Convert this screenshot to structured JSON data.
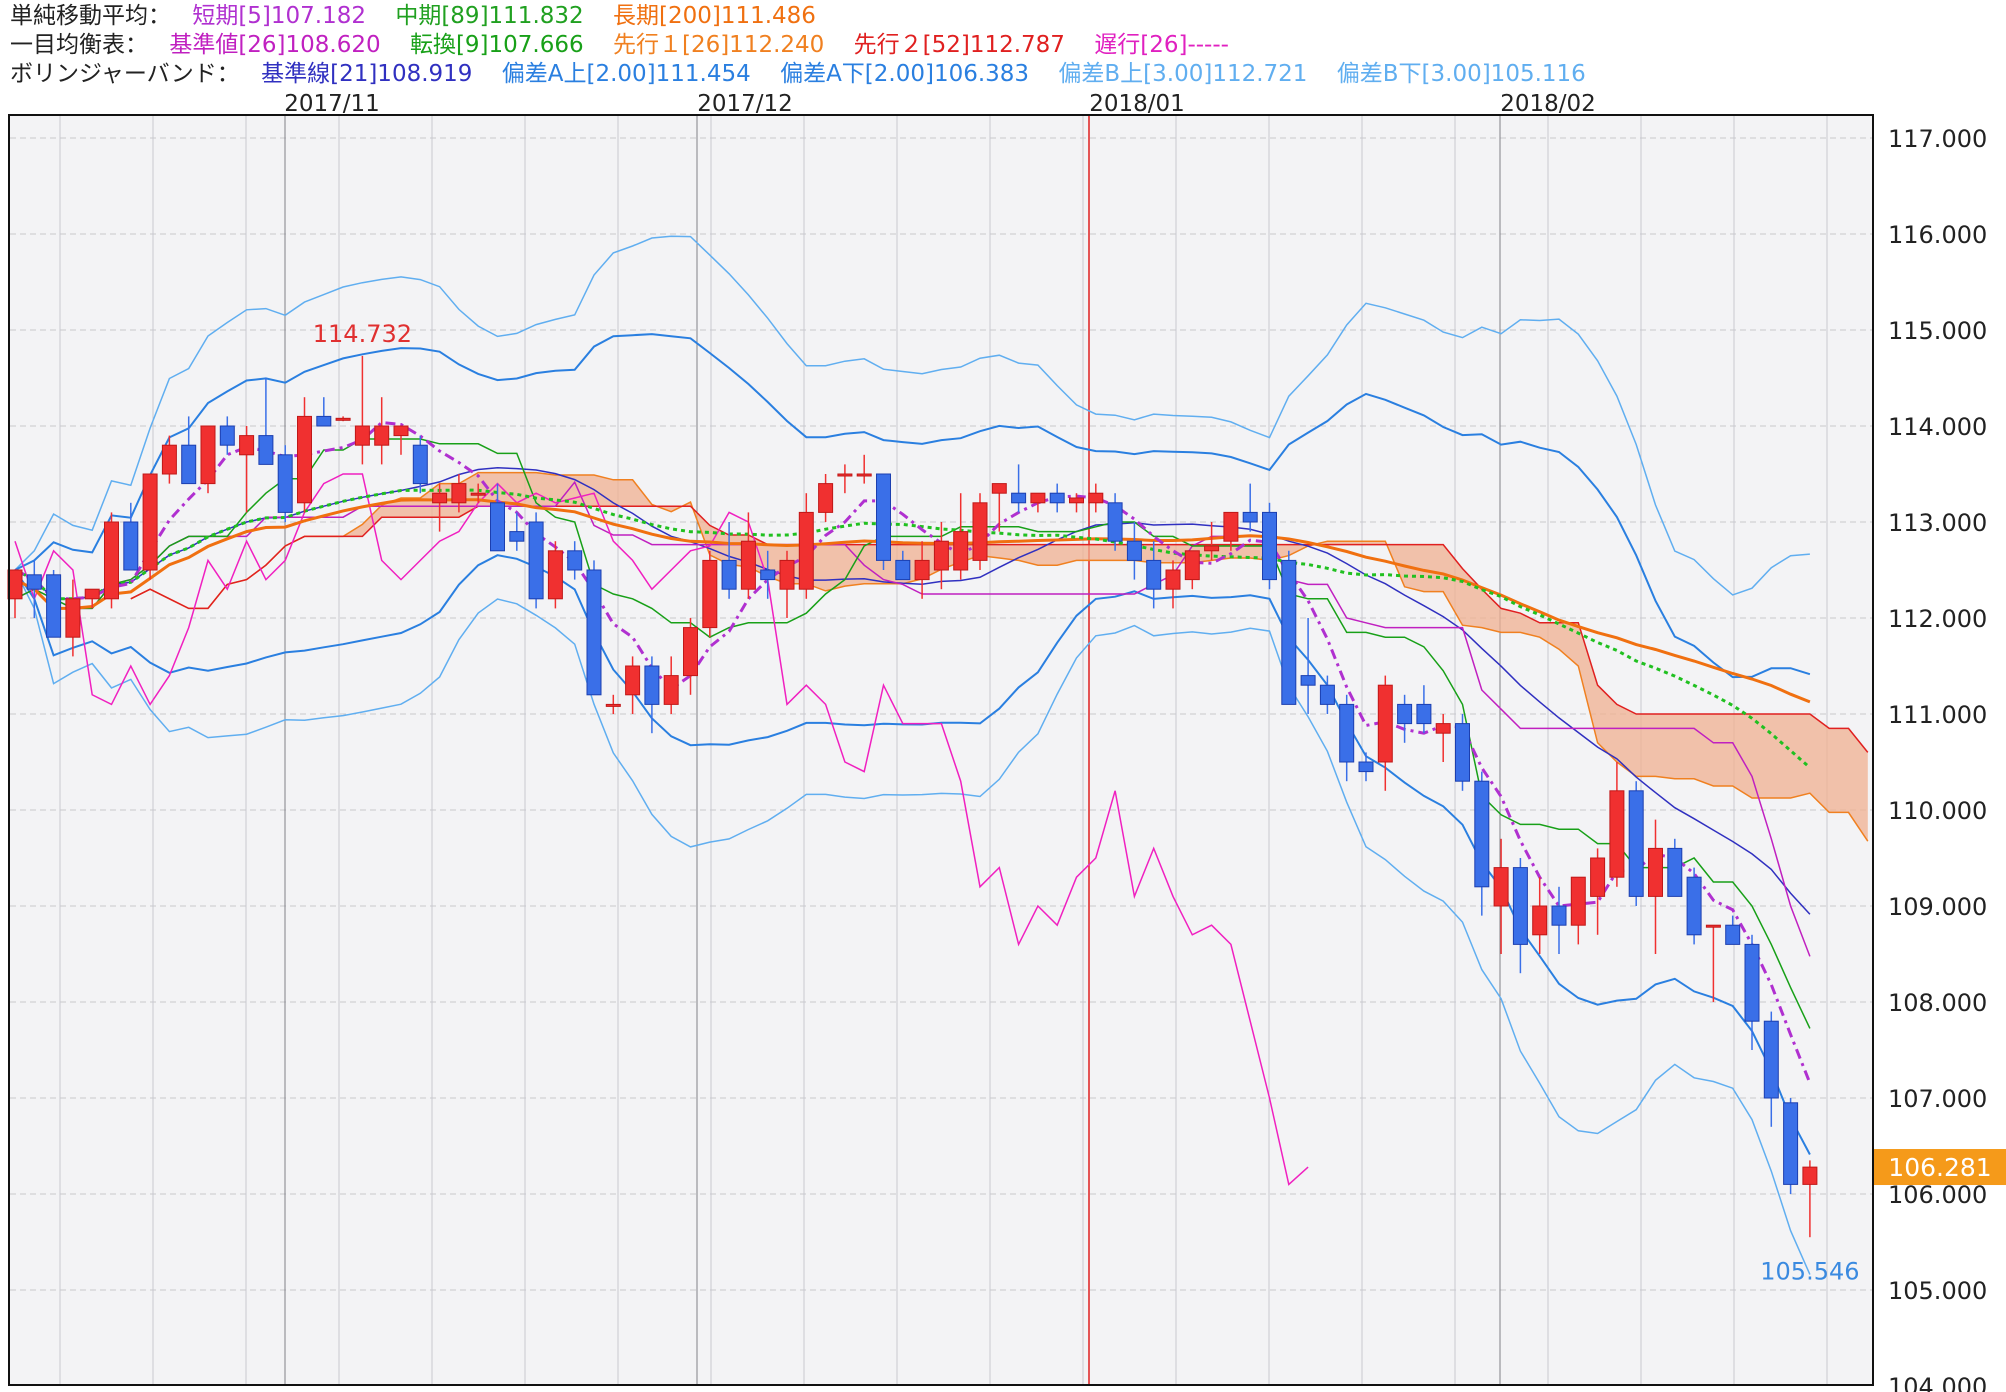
{
  "legend": {
    "sma": {
      "title": "単純移動平均：",
      "items": [
        {
          "label": "短期[5]107.182",
          "color": "#b030d0"
        },
        {
          "label": "中期[89]111.832",
          "color": "#20a020"
        },
        {
          "label": "長期[200]111.486",
          "color": "#f07010"
        }
      ]
    },
    "ichimoku": {
      "title": "一目均衡表：",
      "items": [
        {
          "label": "基準値[26]108.620",
          "color": "#c020c0"
        },
        {
          "label": "転換[9]107.666",
          "color": "#18a018"
        },
        {
          "label": "先行１[26]112.240",
          "color": "#f08020"
        },
        {
          "label": "先行２[52]112.787",
          "color": "#e02020"
        },
        {
          "label": "遅行[26]-----",
          "color": "#e020c0"
        }
      ]
    },
    "bollinger": {
      "title": "ボリンジャーバンド：",
      "items": [
        {
          "label": "基準線[21]108.919",
          "color": "#3030c0"
        },
        {
          "label": "偏差A上[2.00]111.454",
          "color": "#2a7fe0"
        },
        {
          "label": "偏差A下[2.00]106.383",
          "color": "#2a7fe0"
        },
        {
          "label": "偏差B上[3.00]112.721",
          "color": "#60aef0"
        },
        {
          "label": "偏差B下[3.00]105.116",
          "color": "#60aef0"
        }
      ]
    }
  },
  "chart_data": {
    "type": "candlestick",
    "x_labels": [
      "2017/11",
      "2017/12",
      "2018/01",
      "2018/02"
    ],
    "y_ticks": [
      "117.000",
      "116.000",
      "115.000",
      "114.000",
      "113.000",
      "112.000",
      "111.000",
      "110.000",
      "109.000",
      "108.000",
      "107.000",
      "106.000",
      "105.000",
      "104.000"
    ],
    "ylim": [
      104,
      117.3
    ],
    "current_price": "106.281",
    "high_label": "114.732",
    "low_label": "105.546",
    "colors": {
      "up": "#f03030",
      "down": "#3a6fe8",
      "cloud_up": "#f0b090",
      "cloud_down": "#e6e6e8",
      "current_bg": "#f59a1a"
    },
    "candles": [
      {
        "o": 112.2,
        "h": 112.4,
        "l": 112.0,
        "c": 112.5
      },
      {
        "o": 112.45,
        "h": 112.6,
        "l": 112.0,
        "c": 112.3
      },
      {
        "o": 112.45,
        "h": 112.5,
        "l": 111.8,
        "c": 111.8
      },
      {
        "o": 111.8,
        "h": 112.4,
        "l": 111.6,
        "c": 112.2
      },
      {
        "o": 112.2,
        "h": 112.3,
        "l": 112.1,
        "c": 112.3
      },
      {
        "o": 112.2,
        "h": 113.1,
        "l": 112.1,
        "c": 113.0
      },
      {
        "o": 113.0,
        "h": 113.2,
        "l": 112.5,
        "c": 112.5
      },
      {
        "o": 112.5,
        "h": 113.5,
        "l": 112.4,
        "c": 113.5
      },
      {
        "o": 113.5,
        "h": 113.9,
        "l": 113.4,
        "c": 113.8
      },
      {
        "o": 113.8,
        "h": 114.1,
        "l": 113.6,
        "c": 113.4
      },
      {
        "o": 113.4,
        "h": 114.0,
        "l": 113.3,
        "c": 114.0
      },
      {
        "o": 114.0,
        "h": 114.1,
        "l": 113.7,
        "c": 113.8
      },
      {
        "o": 113.7,
        "h": 114.0,
        "l": 113.1,
        "c": 113.9
      },
      {
        "o": 113.9,
        "h": 114.5,
        "l": 113.6,
        "c": 113.6
      },
      {
        "o": 113.7,
        "h": 113.8,
        "l": 113.0,
        "c": 113.1
      },
      {
        "o": 113.2,
        "h": 114.3,
        "l": 113.1,
        "c": 114.1
      },
      {
        "o": 114.1,
        "h": 114.3,
        "l": 114.0,
        "c": 114.0
      },
      {
        "o": 114.08,
        "h": 114.1,
        "l": 114.05,
        "c": 114.08
      },
      {
        "o": 113.8,
        "h": 114.73,
        "l": 113.6,
        "c": 114.0
      },
      {
        "o": 113.8,
        "h": 114.3,
        "l": 113.6,
        "c": 114.0
      },
      {
        "o": 113.9,
        "h": 114.0,
        "l": 113.7,
        "c": 114.0
      },
      {
        "o": 113.8,
        "h": 113.9,
        "l": 113.3,
        "c": 113.4
      },
      {
        "o": 113.2,
        "h": 113.4,
        "l": 112.9,
        "c": 113.3
      },
      {
        "o": 113.2,
        "h": 113.5,
        "l": 113.1,
        "c": 113.4
      },
      {
        "o": 113.3,
        "h": 113.4,
        "l": 113.2,
        "c": 113.3
      },
      {
        "o": 113.2,
        "h": 113.4,
        "l": 112.7,
        "c": 112.7
      },
      {
        "o": 112.9,
        "h": 113.1,
        "l": 112.7,
        "c": 112.8
      },
      {
        "o": 113.0,
        "h": 113.1,
        "l": 112.1,
        "c": 112.2
      },
      {
        "o": 112.2,
        "h": 112.8,
        "l": 112.1,
        "c": 112.7
      },
      {
        "o": 112.7,
        "h": 112.8,
        "l": 112.4,
        "c": 112.5
      },
      {
        "o": 112.5,
        "h": 112.6,
        "l": 111.2,
        "c": 111.2
      },
      {
        "o": 111.1,
        "h": 111.2,
        "l": 111.0,
        "c": 111.1
      },
      {
        "o": 111.2,
        "h": 111.6,
        "l": 111.0,
        "c": 111.5
      },
      {
        "o": 111.5,
        "h": 111.6,
        "l": 110.8,
        "c": 111.1
      },
      {
        "o": 111.1,
        "h": 111.6,
        "l": 111.0,
        "c": 111.4
      },
      {
        "o": 111.4,
        "h": 112.0,
        "l": 111.2,
        "c": 111.9
      },
      {
        "o": 111.9,
        "h": 112.7,
        "l": 111.8,
        "c": 112.6
      },
      {
        "o": 112.6,
        "h": 113.0,
        "l": 112.2,
        "c": 112.3
      },
      {
        "o": 112.3,
        "h": 113.1,
        "l": 112.2,
        "c": 112.8
      },
      {
        "o": 112.5,
        "h": 112.7,
        "l": 112.2,
        "c": 112.4
      },
      {
        "o": 112.3,
        "h": 112.7,
        "l": 112.0,
        "c": 112.6
      },
      {
        "o": 112.3,
        "h": 113.3,
        "l": 112.2,
        "c": 113.1
      },
      {
        "o": 113.1,
        "h": 113.5,
        "l": 113.0,
        "c": 113.4
      },
      {
        "o": 113.5,
        "h": 113.6,
        "l": 113.3,
        "c": 113.5
      },
      {
        "o": 113.5,
        "h": 113.7,
        "l": 113.4,
        "c": 113.5
      },
      {
        "o": 113.5,
        "h": 113.5,
        "l": 112.5,
        "c": 112.6
      },
      {
        "o": 112.6,
        "h": 112.7,
        "l": 112.4,
        "c": 112.4
      },
      {
        "o": 112.4,
        "h": 112.8,
        "l": 112.2,
        "c": 112.6
      },
      {
        "o": 112.5,
        "h": 113.0,
        "l": 112.3,
        "c": 112.8
      },
      {
        "o": 112.5,
        "h": 113.3,
        "l": 112.4,
        "c": 112.9
      },
      {
        "o": 112.6,
        "h": 113.3,
        "l": 112.5,
        "c": 113.2
      },
      {
        "o": 113.3,
        "h": 113.4,
        "l": 112.9,
        "c": 113.4
      },
      {
        "o": 113.3,
        "h": 113.6,
        "l": 113.1,
        "c": 113.2
      },
      {
        "o": 113.2,
        "h": 113.3,
        "l": 113.1,
        "c": 113.3
      },
      {
        "o": 113.3,
        "h": 113.4,
        "l": 113.1,
        "c": 113.2
      },
      {
        "o": 113.2,
        "h": 113.3,
        "l": 113.1,
        "c": 113.25
      },
      {
        "o": 113.2,
        "h": 113.4,
        "l": 113.1,
        "c": 113.3
      },
      {
        "o": 113.2,
        "h": 113.3,
        "l": 112.7,
        "c": 112.8
      },
      {
        "o": 112.8,
        "h": 113.0,
        "l": 112.4,
        "c": 112.6
      },
      {
        "o": 112.6,
        "h": 112.8,
        "l": 112.1,
        "c": 112.3
      },
      {
        "o": 112.3,
        "h": 112.6,
        "l": 112.1,
        "c": 112.5
      },
      {
        "o": 112.4,
        "h": 112.7,
        "l": 112.3,
        "c": 112.7
      },
      {
        "o": 112.7,
        "h": 113.0,
        "l": 112.6,
        "c": 112.75
      },
      {
        "o": 112.8,
        "h": 113.1,
        "l": 112.7,
        "c": 113.1
      },
      {
        "o": 113.1,
        "h": 113.4,
        "l": 112.9,
        "c": 113.0
      },
      {
        "o": 113.1,
        "h": 113.2,
        "l": 112.3,
        "c": 112.4
      },
      {
        "o": 112.6,
        "h": 112.7,
        "l": 111.1,
        "c": 111.1
      },
      {
        "o": 111.4,
        "h": 112.0,
        "l": 111.0,
        "c": 111.3
      },
      {
        "o": 111.3,
        "h": 111.4,
        "l": 111.0,
        "c": 111.1
      },
      {
        "o": 111.1,
        "h": 111.2,
        "l": 110.3,
        "c": 110.5
      },
      {
        "o": 110.5,
        "h": 110.6,
        "l": 110.3,
        "c": 110.4
      },
      {
        "o": 110.5,
        "h": 111.4,
        "l": 110.2,
        "c": 111.3
      },
      {
        "o": 111.1,
        "h": 111.2,
        "l": 110.7,
        "c": 110.9
      },
      {
        "o": 111.1,
        "h": 111.3,
        "l": 110.8,
        "c": 110.9
      },
      {
        "o": 110.8,
        "h": 111.0,
        "l": 110.5,
        "c": 110.9
      },
      {
        "o": 110.9,
        "h": 111.0,
        "l": 110.2,
        "c": 110.3
      },
      {
        "o": 110.3,
        "h": 110.4,
        "l": 108.9,
        "c": 109.2
      },
      {
        "o": 109.0,
        "h": 109.7,
        "l": 108.5,
        "c": 109.4
      },
      {
        "o": 109.4,
        "h": 109.5,
        "l": 108.3,
        "c": 108.6
      },
      {
        "o": 108.7,
        "h": 109.3,
        "l": 108.5,
        "c": 109.0
      },
      {
        "o": 109.0,
        "h": 109.2,
        "l": 108.5,
        "c": 108.8
      },
      {
        "o": 108.8,
        "h": 109.3,
        "l": 108.6,
        "c": 109.3
      },
      {
        "o": 109.1,
        "h": 109.6,
        "l": 108.7,
        "c": 109.5
      },
      {
        "o": 109.3,
        "h": 110.5,
        "l": 109.2,
        "c": 110.2
      },
      {
        "o": 110.2,
        "h": 110.3,
        "l": 109.0,
        "c": 109.1
      },
      {
        "o": 109.1,
        "h": 109.9,
        "l": 108.5,
        "c": 109.6
      },
      {
        "o": 109.6,
        "h": 109.7,
        "l": 109.2,
        "c": 109.1
      },
      {
        "o": 109.3,
        "h": 109.4,
        "l": 108.6,
        "c": 108.7
      },
      {
        "o": 108.8,
        "h": 108.8,
        "l": 108.0,
        "c": 108.8
      },
      {
        "o": 108.8,
        "h": 108.9,
        "l": 108.6,
        "c": 108.6
      },
      {
        "o": 108.6,
        "h": 108.7,
        "l": 107.5,
        "c": 107.8
      },
      {
        "o": 107.8,
        "h": 107.9,
        "l": 106.7,
        "c": 107.0
      },
      {
        "o": 106.95,
        "h": 107.0,
        "l": 106.0,
        "c": 106.1
      },
      {
        "o": 106.1,
        "h": 106.35,
        "l": 105.55,
        "c": 106.28
      }
    ]
  }
}
